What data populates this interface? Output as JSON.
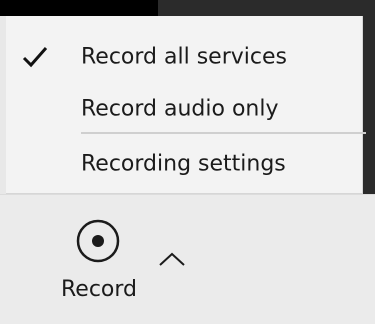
{
  "menu": {
    "items": [
      {
        "label": "Record all services",
        "checked": true
      },
      {
        "label": "Record audio only",
        "checked": false
      },
      {
        "label": "Recording settings",
        "checked": false
      }
    ]
  },
  "toolbar": {
    "record_label": "Record",
    "record_icon": "record-icon",
    "expand_icon": "chevron-up-icon"
  }
}
